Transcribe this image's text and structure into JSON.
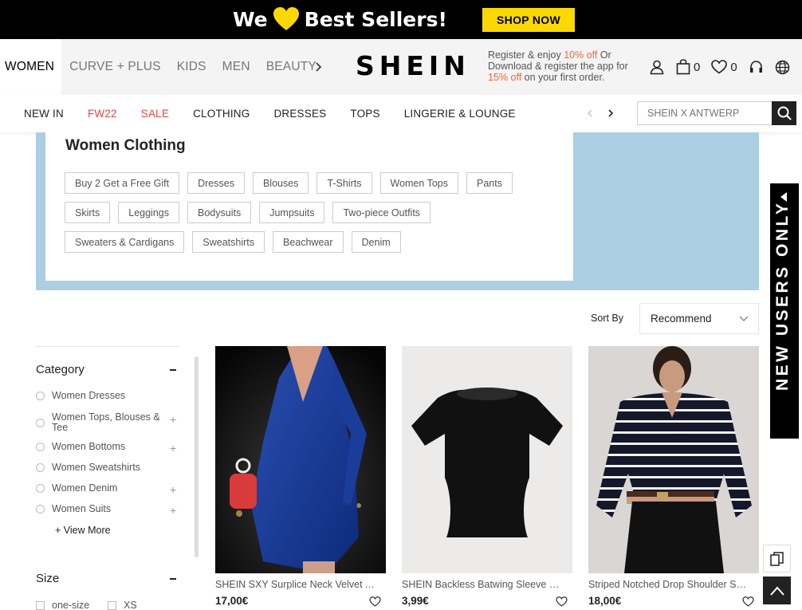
{
  "promo": {
    "text_before": "We",
    "text_after": "Best Sellers!",
    "shop_now": "SHOP NOW",
    "colors": {
      "background": "#000000",
      "accent": "#fbd804"
    }
  },
  "header": {
    "category_tabs": [
      "WOMEN",
      "CURVE + PLUS",
      "KIDS",
      "MEN",
      "BEAUTY"
    ],
    "logo": "SHEIN",
    "register": {
      "line1_a": "Register & enjoy ",
      "line1_red": "10% off",
      "line1_b": " Or",
      "line2": "Download & register the app for",
      "line3_red": "15% off",
      "line3_b": " on your first order."
    },
    "cart_count": "0",
    "wishlist_count": "0"
  },
  "nav": {
    "items": [
      {
        "label": "NEW IN",
        "highlight": false
      },
      {
        "label": "FW22",
        "highlight": true
      },
      {
        "label": "SALE",
        "highlight": true
      },
      {
        "label": "CLOTHING",
        "highlight": false
      },
      {
        "label": "DRESSES",
        "highlight": false
      },
      {
        "label": "TOPS",
        "highlight": false
      },
      {
        "label": "LINGERIE & LOUNGE",
        "highlight": false
      }
    ],
    "search_placeholder": "SHEIN X ANTWERP"
  },
  "hero": {
    "title": "Women Clothing",
    "chips": [
      [
        "Buy 2 Get a Free Gift",
        "Dresses",
        "Blouses",
        "T-Shirts",
        "Women Tops",
        "Pants"
      ],
      [
        "Skirts",
        "Leggings",
        "Bodysuits",
        "Jumpsuits",
        "Two-piece Outfits"
      ],
      [
        "Sweaters & Cardigans",
        "Sweatshirts",
        "Beachwear",
        "Denim"
      ]
    ],
    "background": "#abcee3"
  },
  "new_users": "NEW USERS ONLY",
  "sort": {
    "label": "Sort By",
    "value": "Recommend"
  },
  "filters": {
    "category_title": "Category",
    "categories": [
      {
        "label": "Women Dresses",
        "expandable": false
      },
      {
        "label": "Women Tops, Blouses & Tee",
        "expandable": true
      },
      {
        "label": "Women Bottoms",
        "expandable": true
      },
      {
        "label": "Women Sweatshirts",
        "expandable": false
      },
      {
        "label": "Women Denim",
        "expandable": true
      },
      {
        "label": "Women Suits",
        "expandable": true
      }
    ],
    "view_more": "+ View More",
    "size_title": "Size",
    "sizes": [
      "one-size",
      "XS"
    ]
  },
  "products": [
    {
      "name": "SHEIN SXY Surplice Neck Velvet A-line Dress",
      "price": "17,00€"
    },
    {
      "name": "SHEIN Backless Batwing Sleeve Solid Tee",
      "price": "3,99€"
    },
    {
      "name": "Striped Notched Drop Shoulder Sweater",
      "price": "18,00€"
    }
  ]
}
